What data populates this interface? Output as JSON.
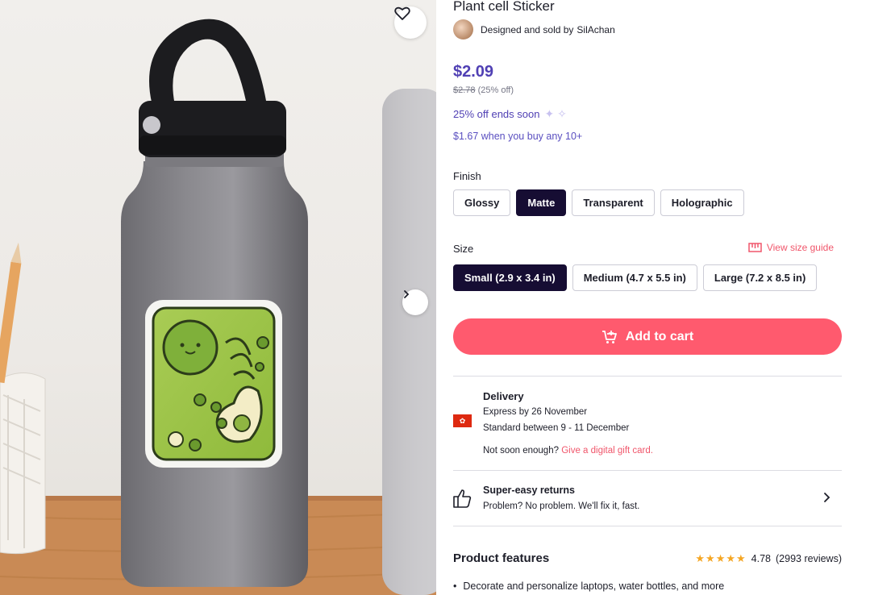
{
  "product": {
    "title": "Plant cell Sticker",
    "seller_prefix": "Designed and sold by",
    "seller_name": "SilAchan"
  },
  "pricing": {
    "price": "$2.09",
    "old_price": "$2.78",
    "discount": "(25% off)",
    "promo": "25% off ends soon",
    "bulk": "$1.67 when you buy any 10+"
  },
  "finish": {
    "label": "Finish",
    "options": [
      "Glossy",
      "Matte",
      "Transparent",
      "Holographic"
    ],
    "selected": "Matte"
  },
  "size": {
    "label": "Size",
    "guide": "View size guide",
    "options": [
      "Small (2.9 x 3.4 in)",
      "Medium (4.7 x 5.5 in)",
      "Large (7.2 x 8.5 in)"
    ],
    "selected": "Small (2.9 x 3.4 in)"
  },
  "cart": {
    "label": "Add to cart"
  },
  "delivery": {
    "title": "Delivery",
    "express": "Express by 26 November",
    "standard": "Standard between 9 - 11 December",
    "not_soon": "Not soon enough?",
    "gift_link": "Give a digital gift card."
  },
  "returns": {
    "title": "Super-easy returns",
    "subtitle": "Problem? No problem. We'll fix it, fast."
  },
  "features": {
    "title": "Product features",
    "rating": "4.78",
    "reviews": "(2993 reviews)",
    "bullets": [
      "Decorate and personalize laptops, water bottles, and more"
    ]
  },
  "colors": {
    "accent_purple": "#5040b4",
    "cart_red": "#ff5a6e",
    "selected_dark": "#160d33",
    "link_pink": "#f0566b",
    "star_gold": "#f5a623"
  },
  "icons": [
    "heart-icon",
    "chevron-right-icon",
    "ruler-icon",
    "cart-icon",
    "hk-flag-icon",
    "thumbs-up-icon",
    "star-icon",
    "sparkle-icon"
  ]
}
